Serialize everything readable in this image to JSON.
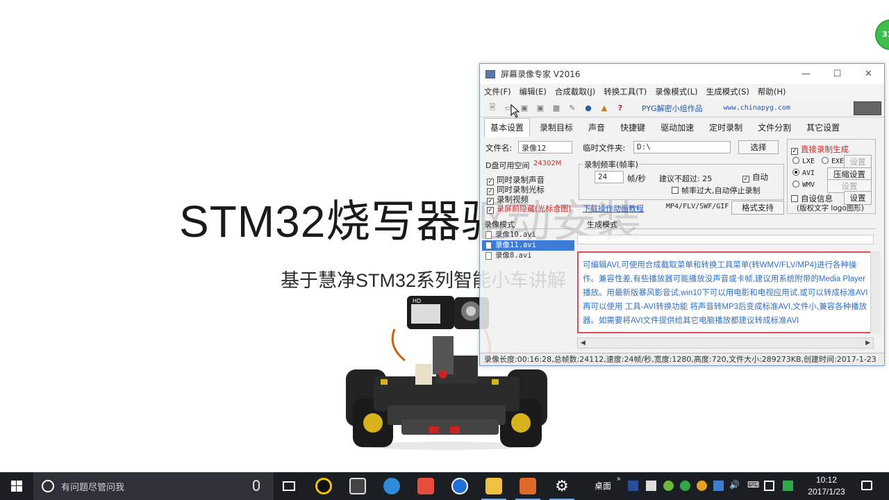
{
  "slide": {
    "title": "STM32烧写器驱动安装",
    "subtitle": "基于慧净STM32系列智能小车讲解"
  },
  "badge": {
    "text": "31"
  },
  "recorder": {
    "title": "屏幕录像专家 V2016",
    "menu": [
      "文件(F)",
      "编辑(E)",
      "合成截取(J)",
      "转换工具(T)",
      "录像模式(L)",
      "生成模式(S)",
      "帮助(H)"
    ],
    "toolbar_link1": "PYG解密小组作品",
    "toolbar_link2": "www.chinapyg.com",
    "tabs": [
      "基本设置",
      "录制目标",
      "声音",
      "快捷键",
      "驱动加速",
      "定时录制",
      "文件分割",
      "其它设置"
    ],
    "filename_label": "文件名:",
    "filename_value": "录像12",
    "temp_folder_label": "临时文件夹:",
    "temp_folder_value": "D:\\",
    "choose_button": "选择",
    "disk_space_label": "D盘可用空间",
    "disk_space_value": "24302M",
    "framerate_group": "录制频率(帧率)",
    "fps_value": "24",
    "fps_unit": "帧/秒",
    "advise_label": "建议不超过: 25",
    "auto_label": "自动",
    "auto_stop_label": "帧率过大,自动停止录制",
    "check_sound": "同时录制声音",
    "check_cursor": "同时录制光标",
    "check_video": "录制视频",
    "red_link": "录屏前隐藏(光标合图)",
    "blue_link": "下载操作动画教程",
    "format_label": "MP4/FLV/SWF/GIF",
    "format_support": "格式支持",
    "direct_gen": "直接录制生成",
    "opt_lxe": "LXE",
    "opt_exe": "EXE",
    "opt_avi": "AVI",
    "opt_wmv": "WMV",
    "settings_button": "设置",
    "compress_settings": "压缩设置",
    "settings_button2": "设置",
    "custom_info": "自设信息",
    "settings_button3": "设置",
    "copyright_note": "(版权文字 logo图形)",
    "record_mode_label": "录像模式",
    "gen_mode_label": "生成模式",
    "files": [
      {
        "name": "录像10.avi",
        "selected": false
      },
      {
        "name": "录像11.avi",
        "selected": true
      },
      {
        "name": "录像8.avi",
        "selected": false
      }
    ],
    "info_text": "可编辑AVI,可使用合成截取菜单和转换工具菜单(转WMV/FLV/MP4)进行各种操作。兼容性差,有些播放器可能播放没声音或卡帧,建议用系统附带的Media Player播放。用最新版暴风影音试,win10下可以用电影和电视应用试,或可以转成标准AVI再可以使用 工具-AVI转换功能 将声音转MP3后变成标准AVI,文件小,兼容各种播放器。如需要将AVI文件提供给其它电脑播放都建议转成标准AVI",
    "status": "录像长度:00:16:28,总帧数:24112,速度:24帧/秒,宽度:1280,高度:720,文件大小:289273KB,创建时间:2017-1-23"
  },
  "taskbar": {
    "search_placeholder": "有问题尽管问我",
    "desktop_label": "桌面",
    "time": "10:12",
    "date": "2017/1/23"
  },
  "colors": {
    "taskbar_bg": "#1b1f24",
    "accent_blue": "#2255cc",
    "info_border": "#e04a5a",
    "badge_green": "#3cbf4c"
  }
}
